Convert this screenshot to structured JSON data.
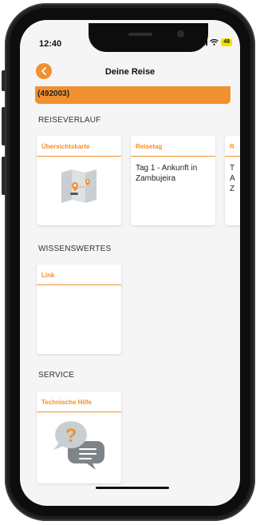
{
  "status_bar": {
    "time": "12:40",
    "battery": "49"
  },
  "nav": {
    "title": "Deine Reise"
  },
  "banner": {
    "text": "(492003)"
  },
  "sections": {
    "reiseverlauf": "REISEVERLAUF",
    "wissenswertes": "WISSENSWERTES",
    "service": "SERVICE"
  },
  "cards": {
    "uebersichtskarte": {
      "title": "Übersichtskarte",
      "icon": "map-icon"
    },
    "reisetag": {
      "title": "Reisetag",
      "body": "Tag 1 - Ankunft in Zambujeira"
    },
    "reisetag_next": {
      "title": "R",
      "body": "T\nA\nZ"
    },
    "link": {
      "title": "Link"
    },
    "technische_hilfe": {
      "title": "Technische Hilfe",
      "icon": "help-chat-icon"
    }
  },
  "colors": {
    "accent": "#f0912f",
    "background": "#f5f5f6",
    "card": "#ffffff",
    "battery": "#f2e200"
  }
}
